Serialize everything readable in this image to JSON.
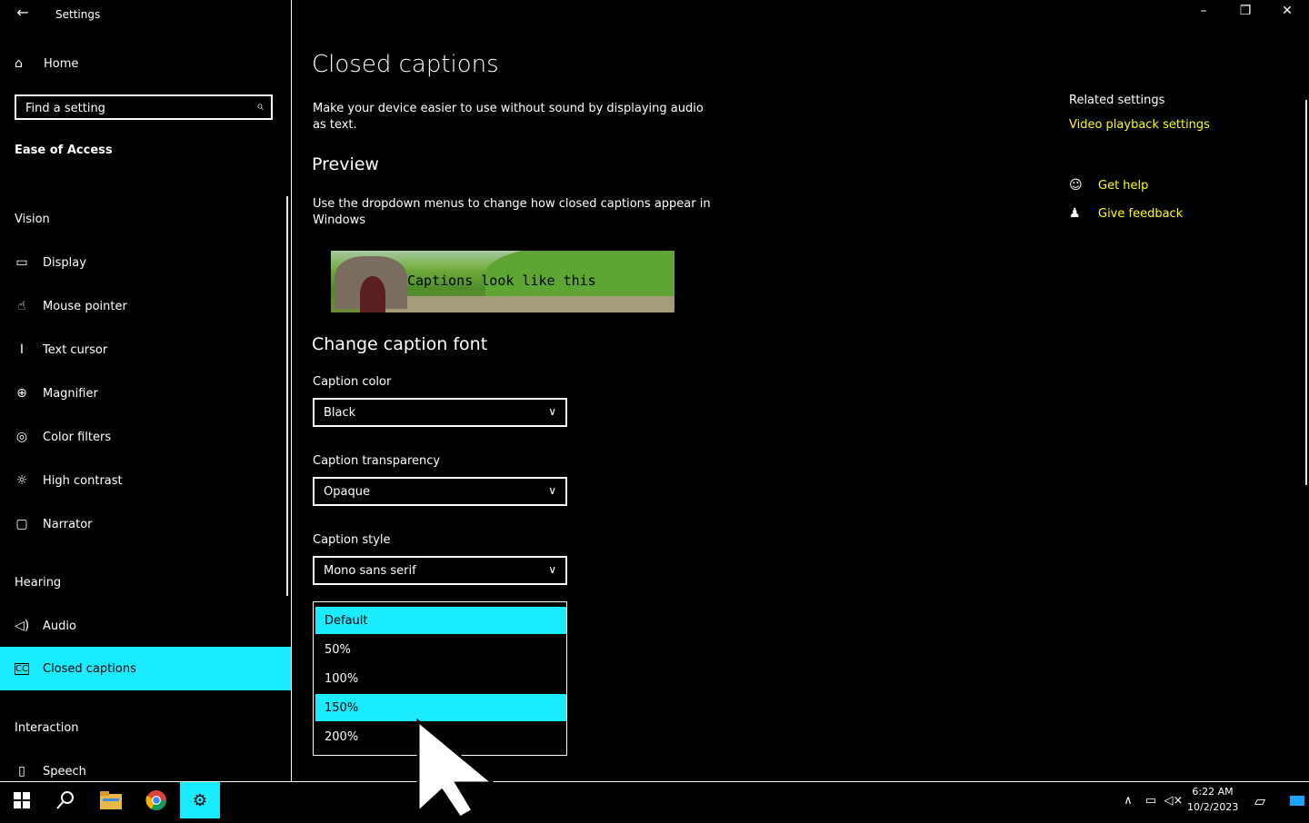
{
  "window": {
    "title": "Settings",
    "back_icon": "back-arrow-icon",
    "controls": {
      "minimize": "–",
      "restore": "❐",
      "close": "✕"
    }
  },
  "sidebar": {
    "home_label": "Home",
    "search_placeholder": "Find a setting",
    "section_title": "Ease of Access",
    "groups": {
      "vision": "Vision",
      "hearing": "Hearing",
      "interaction": "Interaction"
    },
    "items": [
      {
        "label": "Display",
        "icon": "monitor-icon"
      },
      {
        "label": "Mouse pointer",
        "icon": "mouse-pointer-icon"
      },
      {
        "label": "Text cursor",
        "icon": "text-cursor-icon"
      },
      {
        "label": "Magnifier",
        "icon": "magnifier-icon"
      },
      {
        "label": "Color filters",
        "icon": "color-filters-icon"
      },
      {
        "label": "High contrast",
        "icon": "high-contrast-icon"
      },
      {
        "label": "Narrator",
        "icon": "narrator-icon"
      },
      {
        "label": "Audio",
        "icon": "speaker-icon"
      },
      {
        "label": "Closed captions",
        "icon": "closed-captions-icon",
        "selected": true
      },
      {
        "label": "Speech",
        "icon": "microphone-icon"
      }
    ]
  },
  "main": {
    "title": "Closed captions",
    "intro": "Make your device easier to use without sound by displaying audio as text.",
    "preview_heading": "Preview",
    "preview_desc": "Use the dropdown menus to change how closed captions appear in Windows",
    "preview_caption": "Captions look like this",
    "font_heading": "Change caption font",
    "caption_color": {
      "label": "Caption color",
      "value": "Black"
    },
    "caption_transparency": {
      "label": "Caption transparency",
      "value": "Opaque"
    },
    "caption_style": {
      "label": "Caption style",
      "value": "Mono sans serif"
    },
    "size_dropdown": {
      "options": [
        "Default",
        "50%",
        "100%",
        "150%",
        "200%"
      ],
      "selected": "Default",
      "hovered": "150%"
    }
  },
  "related": {
    "title": "Related settings",
    "video_link": "Video playback settings",
    "get_help": "Get help",
    "give_feedback": "Give feedback"
  },
  "taskbar": {
    "time": "6:22 AM",
    "date": "10/2/2023"
  },
  "colors": {
    "accent": "#1aebff",
    "link": "#ffff00",
    "background": "#000000",
    "foreground": "#ffffff"
  }
}
